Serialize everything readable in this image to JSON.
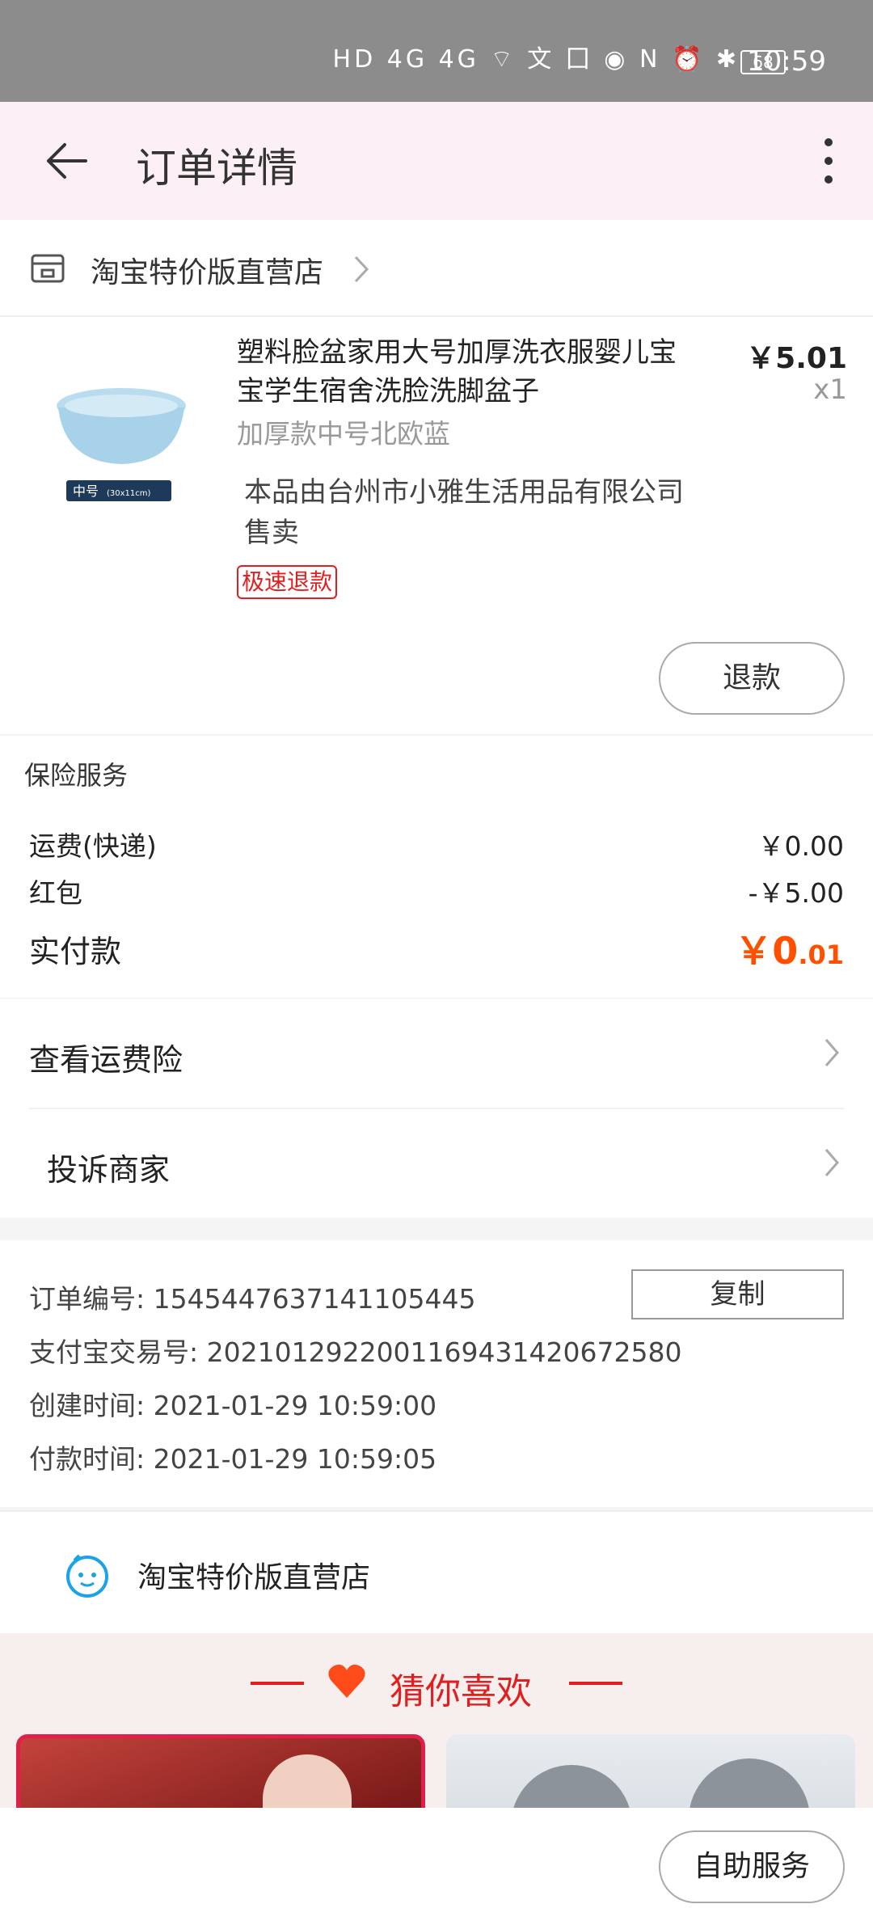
{
  "status_bar": {
    "time": "10:59",
    "battery": "68",
    "icons_text": "HD 4G 4G ⌔ 文 囗 ◉ N ⏰ ✱"
  },
  "header": {
    "title": "订单详情"
  },
  "store": {
    "name": "淘宝特价版直营店"
  },
  "product": {
    "name": "塑料脸盆家用大号加厚洗衣服婴儿宝宝学生宿舍洗脸洗脚盆子",
    "sku": "加厚款中号北欧蓝",
    "price": "￥5.01",
    "quantity": "x1",
    "seller": "本品由台州市小雅生活用品有限公司售卖",
    "tag": "极速退款",
    "thumb_label": "中号",
    "thumb_size": "(30x11cm)",
    "refund_button": "退款"
  },
  "fees": {
    "insurance_label": "保险服务",
    "shipping_label": "运费(快递)",
    "shipping_value": "￥0.00",
    "redpacket_label": "红包",
    "redpacket_value": "-￥5.00",
    "paid_label": "实付款",
    "paid_prefix": "￥0",
    "paid_suffix": ".01"
  },
  "links": {
    "shipping_insurance": "查看运费险",
    "complain": "投诉商家"
  },
  "order_info": {
    "order_no": "订单编号: 1545447637141105445",
    "alipay_no": "支付宝交易号: 2021012922001169431420672580",
    "created": "创建时间: 2021-01-29 10:59:00",
    "paid": "付款时间: 2021-01-29 10:59:05",
    "copy_button": "复制"
  },
  "shop_contact": {
    "name": "淘宝特价版直营店"
  },
  "recommend": {
    "title": "猜你喜欢"
  },
  "bottom": {
    "self_service": "自助服务"
  },
  "colors": {
    "accent": "#ff5000",
    "red": "#e02020",
    "header_bg": "#fcf0f6"
  }
}
